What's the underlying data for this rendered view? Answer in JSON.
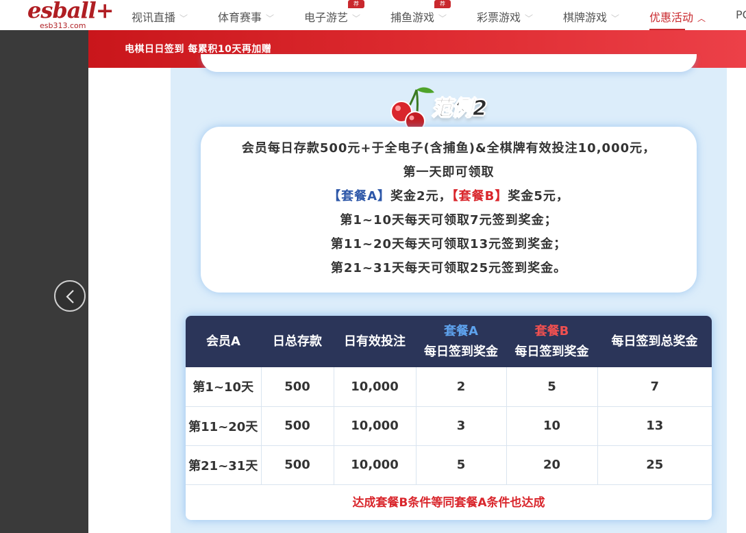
{
  "logo": {
    "main": "esball+",
    "sub": "esb313.com"
  },
  "nav": {
    "items": [
      {
        "label": "视讯直播",
        "badge": ""
      },
      {
        "label": "体育赛事",
        "badge": ""
      },
      {
        "label": "电子游艺",
        "badge": "荐"
      },
      {
        "label": "捕鱼游戏",
        "badge": "荐"
      },
      {
        "label": "彩票游戏",
        "badge": ""
      },
      {
        "label": "棋牌游戏",
        "badge": ""
      },
      {
        "label": "优惠活动",
        "badge": ""
      },
      {
        "label": "PC",
        "badge": ""
      }
    ]
  },
  "modal": {
    "title": "电棋日日签到 每累积10天再加赠"
  },
  "example": {
    "title": "范例2"
  },
  "description": {
    "line1": "会员每日存款500元+于全电子(含捕鱼)&全棋牌有效投注10,000元，",
    "line2": "第一天即可领取",
    "pkg_a": "【套餐A】",
    "pkg_a_text": "奖金2元，",
    "pkg_b": "【套餐B】",
    "pkg_b_text": "奖金5元，",
    "line4": "第1~10天每天可领取7元签到奖金；",
    "line5": "第11~20天每天可领取13元签到奖金；",
    "line6": "第21~31天每天可领取25元签到奖金。"
  },
  "table": {
    "headers": {
      "member": "会员A",
      "deposit": "日总存款",
      "bet": "日有效投注",
      "pkg_a_name": "套餐A",
      "pkg_a_sub": "每日签到奖金",
      "pkg_b_name": "套餐B",
      "pkg_b_sub": "每日签到奖金",
      "total": "每日签到总奖金"
    },
    "rows": [
      {
        "period": "第1~10天",
        "deposit": "500",
        "bet": "10,000",
        "a": "2",
        "b": "5",
        "total": "7"
      },
      {
        "period": "第11~20天",
        "deposit": "500",
        "bet": "10,000",
        "a": "3",
        "b": "10",
        "total": "13"
      },
      {
        "period": "第21~31天",
        "deposit": "500",
        "bet": "10,000",
        "a": "5",
        "b": "20",
        "total": "25"
      }
    ],
    "note": "达成套餐B条件等同套餐A条件也达成"
  },
  "colors": {
    "brand_red": "#c9161b",
    "header_navy": "#2b3559",
    "pkg_a_blue": "#2d57a8",
    "content_bg": "#dcedfa"
  }
}
